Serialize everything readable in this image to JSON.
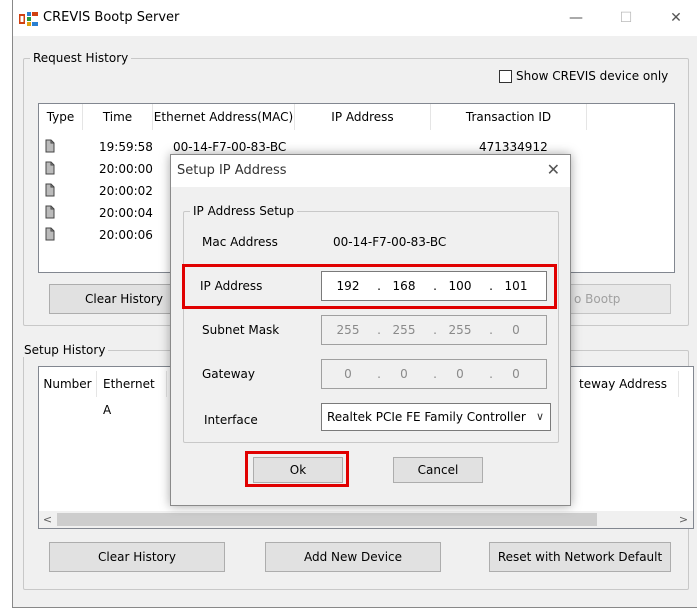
{
  "window": {
    "title": "CREVIS Bootp Server",
    "minimize": "—",
    "maximize": "☐",
    "close": "✕"
  },
  "request_history": {
    "legend": "Request History",
    "show_only_label": "Show CREVIS device only",
    "columns": [
      "Type",
      "Time",
      "Ethernet Address(MAC)",
      "IP Address",
      "Transaction ID"
    ],
    "rows": [
      {
        "time": "19:59:58",
        "mac": "00-14-F7-00-83-BC",
        "ip": "",
        "transaction": "471334912"
      },
      {
        "time": "20:00:00",
        "mac": "",
        "ip": "",
        "transaction": ""
      },
      {
        "time": "20:00:02",
        "mac": "",
        "ip": "",
        "transaction": ""
      },
      {
        "time": "20:00:04",
        "mac": "",
        "ip": "",
        "transaction": ""
      },
      {
        "time": "20:00:06",
        "mac": "",
        "ip": "",
        "transaction": ""
      }
    ],
    "clear_btn": "Clear History",
    "right_btn_partial": "o Bootp"
  },
  "setup_history": {
    "legend": "Setup History",
    "columns_left": [
      "Number",
      "Ethernet A"
    ],
    "column_right_partial": "teway Address",
    "scroll_left": "<",
    "scroll_right": ">",
    "clear_btn": "Clear History",
    "add_btn": "Add New Device",
    "reset_btn": "Reset with Network Default"
  },
  "dialog": {
    "title": "Setup IP Address",
    "close": "✕",
    "group_legend": "IP Address Setup",
    "mac_label": "Mac Address",
    "mac_value": "00-14-F7-00-83-BC",
    "ip_label": "IP Address",
    "ip": [
      "192",
      "168",
      "100",
      "101"
    ],
    "subnet_label": "Subnet Mask",
    "subnet": [
      "255",
      "255",
      "255",
      "0"
    ],
    "gateway_label": "Gateway",
    "gateway": [
      "0",
      "0",
      "0",
      "0"
    ],
    "interface_label": "Interface",
    "interface_value": "Realtek PCIe FE Family Controller",
    "interface_arrow": "∨",
    "ok_btn": "Ok",
    "cancel_btn": "Cancel"
  },
  "colors": {
    "highlight": "#e00000",
    "window_bg": "#f0f0f0",
    "list_bg": "#ffffff"
  }
}
